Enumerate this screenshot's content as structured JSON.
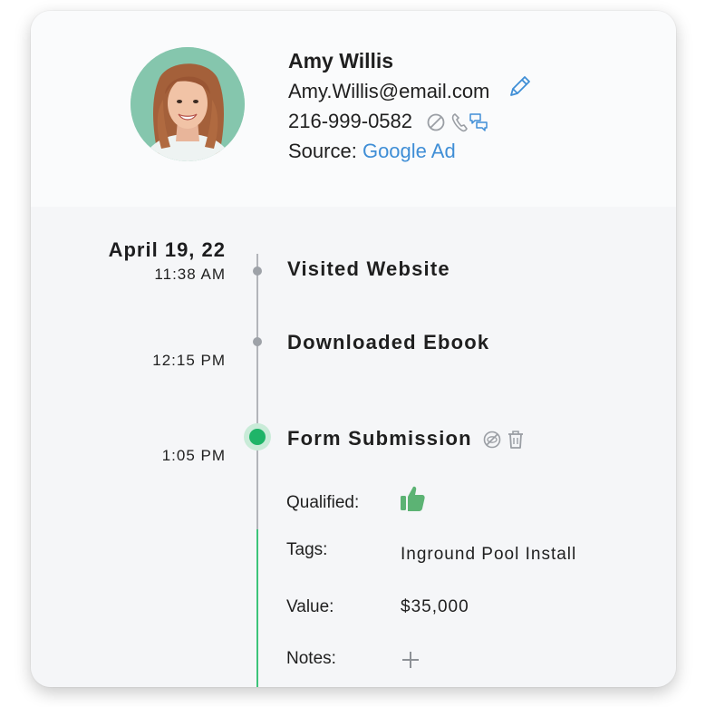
{
  "contact": {
    "name": "Amy Willis",
    "email": "Amy.Willis@email.com",
    "phone": "216-999-0582",
    "source_label": "Source:",
    "source_value": "Google Ad"
  },
  "timeline": {
    "date": "April 19, 22",
    "events": [
      {
        "time": "11:38 AM",
        "title": "Visited Website"
      },
      {
        "time": "12:15 PM",
        "title": "Downloaded Ebook"
      },
      {
        "time": "1:05 PM",
        "title": "Form Submission"
      }
    ]
  },
  "details": {
    "qualified_label": "Qualified:",
    "tags_label": "Tags:",
    "tags_value": "Inground Pool Install",
    "value_label": "Value:",
    "value_value": "$35,000",
    "notes_label": "Notes:"
  },
  "icons": {
    "edit": "pencil-icon",
    "do_not_contact": "block-icon",
    "call": "phone-icon",
    "message": "chat-icon",
    "qualified": "thumbs-up-icon",
    "hide": "eye-slash-icon",
    "delete": "trash-icon",
    "add_note": "plus-icon"
  },
  "colors": {
    "link": "#3f8ed6",
    "active": "#1fb468",
    "thumb": "#5cb374",
    "avatar_bg": "#85c6ad"
  }
}
